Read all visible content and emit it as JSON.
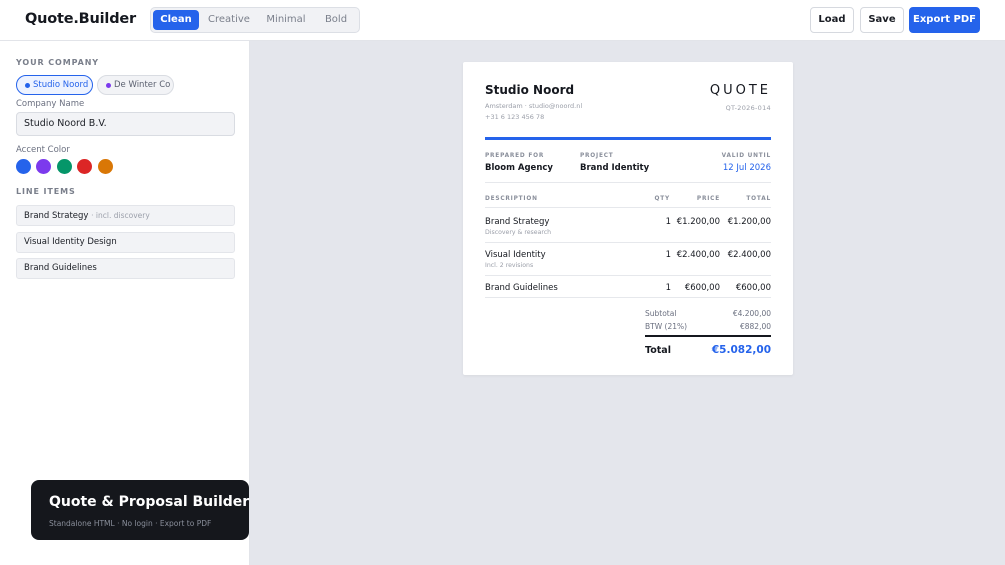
{
  "app": {
    "logo": "Quote.Builder"
  },
  "templates": [
    "Clean",
    "Creative",
    "Minimal",
    "Bold"
  ],
  "toolbar": {
    "load_label": "Load",
    "save_label": "Save",
    "export_label": "Export PDF"
  },
  "sidebar": {
    "your_company_label": "YOUR COMPANY",
    "companies": [
      {
        "label": "Studio Noord",
        "dot_color": "#2563eb",
        "active": true
      },
      {
        "label": "De Winter Co",
        "dot_color": "#7c3aed",
        "active": false
      }
    ],
    "company_name_label": "Company Name",
    "company_name_value": "Studio Noord B.V.",
    "accent_label": "Accent Color",
    "accent_colors": [
      "#2563eb",
      "#7c3aed",
      "#059669",
      "#dc2626",
      "#d97706"
    ],
    "line_items_label": "LINE ITEMS",
    "line_items": [
      {
        "label": "Brand Strategy",
        "note": "· incl. discovery"
      },
      {
        "label": "Visual Identity Design",
        "note": ""
      },
      {
        "label": "Brand Guidelines",
        "note": ""
      }
    ]
  },
  "banner": {
    "title": "Quote & Proposal Builder",
    "subtitle": "Standalone HTML · No login · Export to PDF"
  },
  "quote": {
    "studio_name": "Studio Noord",
    "contact_line1": "Amsterdam · studio@noord.nl",
    "contact_line2": "+31 6 123 456 78",
    "heading": "QUOTE",
    "number": "QT-2026-014",
    "accent_color": "#2563eb",
    "prepared_for_label": "PREPARED FOR",
    "prepared_for": "Bloom Agency",
    "project_label": "PROJECT",
    "project": "Brand Identity",
    "valid_until_label": "VALID UNTIL",
    "valid_until": "12 Jul 2026",
    "columns": {
      "description": "DESCRIPTION",
      "qty": "QTY",
      "price": "PRICE",
      "total": "TOTAL"
    },
    "items": [
      {
        "description": "Brand Strategy",
        "detail": "Discovery & research",
        "qty": "1",
        "price": "€1.200,00",
        "total": "€1.200,00"
      },
      {
        "description": "Visual Identity",
        "detail": "Incl. 2 revisions",
        "qty": "1",
        "price": "€2.400,00",
        "total": "€2.400,00"
      },
      {
        "description": "Brand Guidelines",
        "detail": "",
        "qty": "1",
        "price": "€600,00",
        "total": "€600,00"
      }
    ],
    "subtotal_label": "Subtotal",
    "subtotal": "€4.200,00",
    "tax_label": "BTW (21%)",
    "tax": "€882,00",
    "total_label": "Total",
    "total": "€5.082,00"
  }
}
